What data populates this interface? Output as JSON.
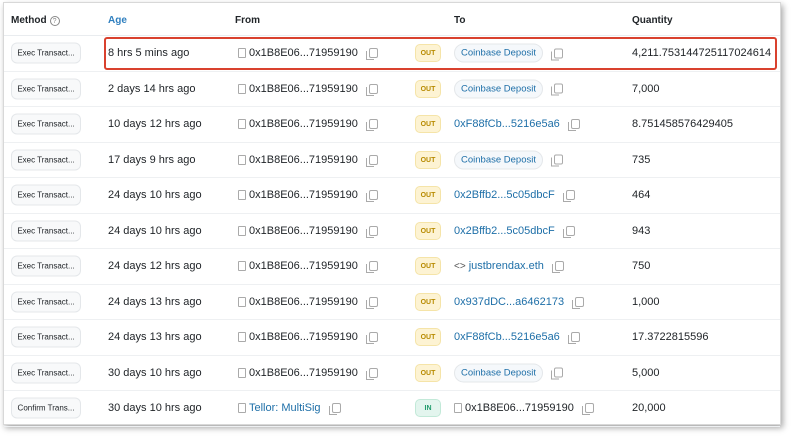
{
  "headers": {
    "method": "Method",
    "age": "Age",
    "from": "From",
    "to": "To",
    "quantity": "Quantity"
  },
  "rows": [
    {
      "method": "Exec Transact...",
      "age": "8 hrs 5 mins ago",
      "from": "0x1B8E06...71959190",
      "from_type": "contract",
      "direction": "OUT",
      "to": "Coinbase Deposit",
      "to_type": "pill",
      "quantity": "4,211.753144725117024614",
      "highlighted": true
    },
    {
      "method": "Exec Transact...",
      "age": "2 days 14 hrs ago",
      "from": "0x1B8E06...71959190",
      "from_type": "contract",
      "direction": "OUT",
      "to": "Coinbase Deposit",
      "to_type": "pill",
      "quantity": "7,000"
    },
    {
      "method": "Exec Transact...",
      "age": "10 days 12 hrs ago",
      "from": "0x1B8E06...71959190",
      "from_type": "contract",
      "direction": "OUT",
      "to": "0xF88fCb...5216e5a6",
      "to_type": "link",
      "quantity": "8.751458576429405"
    },
    {
      "method": "Exec Transact...",
      "age": "17 days 9 hrs ago",
      "from": "0x1B8E06...71959190",
      "from_type": "contract",
      "direction": "OUT",
      "to": "Coinbase Deposit",
      "to_type": "pill",
      "quantity": "735"
    },
    {
      "method": "Exec Transact...",
      "age": "24 days 10 hrs ago",
      "from": "0x1B8E06...71959190",
      "from_type": "contract",
      "direction": "OUT",
      "to": "0x2Bffb2...5c05dbcF",
      "to_type": "link",
      "quantity": "464"
    },
    {
      "method": "Exec Transact...",
      "age": "24 days 10 hrs ago",
      "from": "0x1B8E06...71959190",
      "from_type": "contract",
      "direction": "OUT",
      "to": "0x2Bffb2...5c05dbcF",
      "to_type": "link",
      "quantity": "943"
    },
    {
      "method": "Exec Transact...",
      "age": "24 days 12 hrs ago",
      "from": "0x1B8E06...71959190",
      "from_type": "contract",
      "direction": "OUT",
      "to": "justbrendax.eth",
      "to_type": "ens",
      "quantity": "750"
    },
    {
      "method": "Exec Transact...",
      "age": "24 days 13 hrs ago",
      "from": "0x1B8E06...71959190",
      "from_type": "contract",
      "direction": "OUT",
      "to": "0x937dDC...a6462173",
      "to_type": "link",
      "quantity": "1,000"
    },
    {
      "method": "Exec Transact...",
      "age": "24 days 13 hrs ago",
      "from": "0x1B8E06...71959190",
      "from_type": "contract",
      "direction": "OUT",
      "to": "0xF88fCb...5216e5a6",
      "to_type": "link",
      "quantity": "17.3722815596"
    },
    {
      "method": "Exec Transact...",
      "age": "30 days 10 hrs ago",
      "from": "0x1B8E06...71959190",
      "from_type": "contract",
      "direction": "OUT",
      "to": "Coinbase Deposit",
      "to_type": "pill",
      "quantity": "5,000"
    },
    {
      "method": "Confirm Trans...",
      "age": "30 days 10 hrs ago",
      "from": "Tellor: MultiSig",
      "from_type": "named",
      "direction": "IN",
      "to": "0x1B8E06...71959190",
      "to_type": "contract",
      "quantity": "20,000"
    }
  ],
  "colors": {
    "highlight": "#d9412e",
    "link": "#1e6fa8",
    "out": "#b78a00",
    "in": "#1f9b6b"
  }
}
